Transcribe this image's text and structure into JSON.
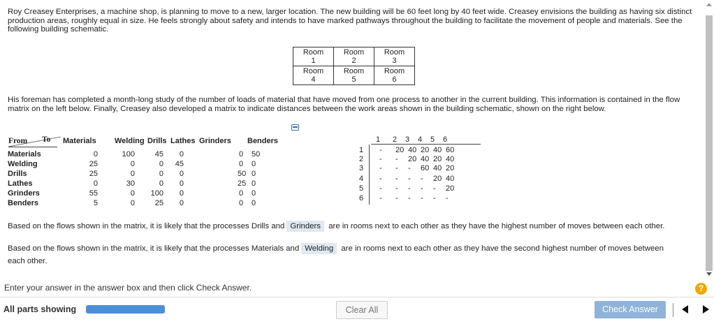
{
  "intro": "Roy Creasey Enterprises, a machine shop, is planning to move to a new, larger location. The new building will be 60 feet long by 40 feet wide. Creasey envisions the building as having six distinct production areas, roughly equal in size. He feels strongly about safety and intends to have marked pathways throughout the building to facilitate the movement of people and materials. See the following building schematic.",
  "schematic": [
    [
      "Room",
      "1",
      "Room",
      "2",
      "Room",
      "3"
    ],
    [
      "Room",
      "4",
      "Room",
      "5",
      "Room",
      "6"
    ]
  ],
  "para2": "His foreman has completed a month-long study of the number of loads of material that have moved from one process to another in the current building. This information is contained in the flow matrix on the left below. Finally, Creasey also developed a matrix to indicate distances between the work areas shown in the building schematic, shown on the right below.",
  "flow": {
    "from_label": "From",
    "to_label": "To",
    "col_headers": [
      "Materials",
      "Welding",
      "Drills",
      "Lathes",
      "Grinders",
      "Benders"
    ],
    "row_labels": [
      "Materials",
      "Welding",
      "Drills",
      "Lathes",
      "Grinders",
      "Benders"
    ],
    "rows": [
      [
        "0",
        "100",
        "45",
        "0",
        "0",
        "50"
      ],
      [
        "25",
        "0",
        "0",
        "45",
        "0",
        "0"
      ],
      [
        "25",
        "0",
        "0",
        "0",
        "50",
        "0"
      ],
      [
        "0",
        "30",
        "0",
        "0",
        "25",
        "0"
      ],
      [
        "55",
        "0",
        "100",
        "0",
        "0",
        "0"
      ],
      [
        "5",
        "0",
        "25",
        "0",
        "0",
        "0"
      ]
    ]
  },
  "distance": {
    "col_headers": [
      "1",
      "2",
      "3",
      "4",
      "5",
      "6"
    ],
    "row_labels": [
      "1",
      "2",
      "3",
      "4",
      "5",
      "6"
    ],
    "rows": [
      [
        "-",
        "20",
        "40",
        "20",
        "40",
        "60"
      ],
      [
        "-",
        "-",
        "20",
        "40",
        "20",
        "40"
      ],
      [
        "-",
        "-",
        "-",
        "60",
        "40",
        "20"
      ],
      [
        "-",
        "-",
        "-",
        "-",
        "20",
        "40"
      ],
      [
        "-",
        "-",
        "-",
        "-",
        "-",
        "20"
      ],
      [
        "-",
        "-",
        "-",
        "-",
        "-",
        "-"
      ]
    ]
  },
  "q1": {
    "before": "Based on the flows shown in the matrix, it is likely that the processes Drills and",
    "answer": "Grinders",
    "after": "are in rooms next to each other as they have the highest number of moves between each other."
  },
  "q2": {
    "before": "Based on the flows shown in the matrix, it is likely that the processes Materials and",
    "answer": "Welding",
    "after": "are in rooms next to each other as they have the second highest number of moves between",
    "after2": "each other."
  },
  "footer": {
    "instruction": "Enter your answer in the answer box and then click Check Answer.",
    "all_parts": "All parts showing",
    "clear_all": "Clear All",
    "check_answer": "Check Answer",
    "help": "?"
  },
  "colors": {
    "accent": "#4a8fd8",
    "check_button": "#8fb3d9",
    "answer_highlight": "#dfe8f3",
    "help": "#f0a800"
  }
}
